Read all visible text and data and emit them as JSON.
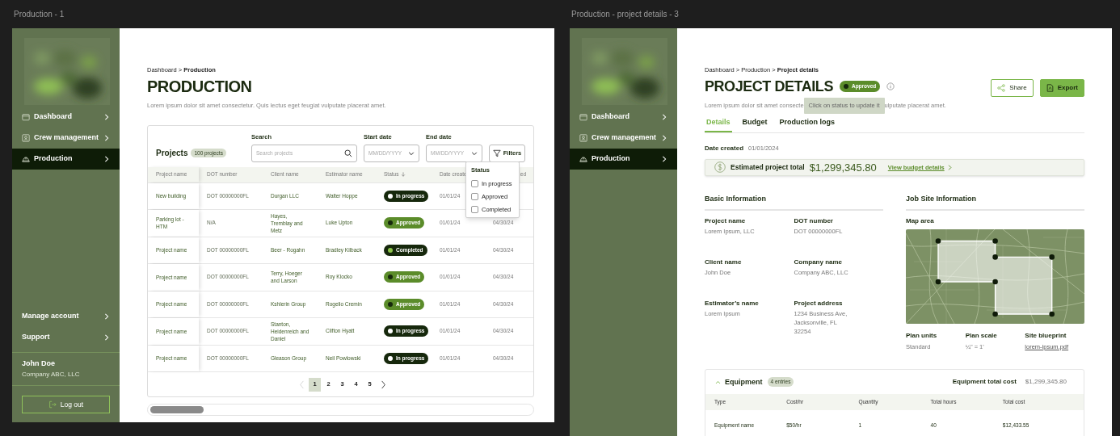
{
  "production_frame": {
    "label": "Production - 1",
    "sidebar": {
      "nav": [
        {
          "label": "Dashboard",
          "selected": false
        },
        {
          "label": "Crew management",
          "selected": false
        },
        {
          "label": "Production",
          "selected": true
        }
      ],
      "account_links": [
        "Manage account",
        "Support"
      ],
      "user": {
        "name": "John Doe",
        "company": "Company ABC, LLC"
      },
      "logout_button": "Log out"
    },
    "breadcrumb": "Dashboard > **Production**",
    "title": "PRODUCTION",
    "description": "Lorem ipsum dolor sit amet consectetur. Quis lectus eget feugiat vulputate placerat amet.",
    "projects": {
      "title": "Projects",
      "count_badge": "100 projects",
      "search": {
        "label": "Search",
        "placeholder": "Search projects"
      },
      "start_date": {
        "label": "Start date",
        "placeholder": "MM/DD/YYYY"
      },
      "end_date": {
        "label": "End date",
        "placeholder": "MM/DD/YYYY"
      },
      "filters_button": "Filters",
      "columns": [
        "Project name",
        "DOT number",
        "Client name",
        "Estimator name",
        "Status",
        "Date create",
        "ed"
      ],
      "rows": [
        {
          "project": "New building",
          "dot": "DOT 00000000FL",
          "client": "Durgan LLC",
          "estimator": "Walter Hoppe",
          "status": "In progress",
          "kind": "in_progress",
          "created": "01/01/24"
        },
        {
          "project": "Parking lot - HTM",
          "dot": "N/A",
          "client": "Hayes, Tremblay and Metz",
          "estimator": "Luke Upton",
          "status": "Approved",
          "kind": "approved",
          "created": "01/01/24",
          "completed": "04/30/24"
        },
        {
          "project": "Project name",
          "dot": "DOT 00000000FL",
          "client": "Beer - Rogahn",
          "estimator": "Bradley Kilback",
          "status": "Completed",
          "kind": "completed",
          "created": "01/01/24",
          "completed": "04/30/24"
        },
        {
          "project": "Project name",
          "dot": "DOT 00000000FL",
          "client": "Terry, Hoeger and Larson",
          "estimator": "Roy Klocko",
          "status": "Approved",
          "kind": "approved",
          "created": "01/01/24",
          "completed": "04/30/24"
        },
        {
          "project": "Project name",
          "dot": "DOT 00000000FL",
          "client": "Kshlerin Group",
          "estimator": "Rogelio Cremin",
          "status": "Approved",
          "kind": "approved",
          "created": "01/01/24",
          "completed": "04/30/24"
        },
        {
          "project": "Project name",
          "dot": "DOT 00000000FL",
          "client": "Stanton, Heidenreich and Daniel",
          "estimator": "Clifton Hyatt",
          "status": "In progress",
          "kind": "in_progress",
          "created": "01/01/24",
          "completed": "04/30/24"
        },
        {
          "project": "Project name",
          "dot": "DOT 00000000FL",
          "client": "Gleason Group",
          "estimator": "Neil Powlowski",
          "status": "In progress",
          "kind": "in_progress",
          "created": "01/01/24",
          "completed": "04/30/24"
        }
      ],
      "status_filter": {
        "title": "Status",
        "options": [
          {
            "label": "In progress",
            "checked": false
          },
          {
            "label": "Approved",
            "checked": false
          },
          {
            "label": "Completed",
            "checked": false
          }
        ]
      },
      "pagination": {
        "previous": {
          "disabled": true
        },
        "next": {
          "disabled": false
        },
        "pages": [
          {
            "label": "1",
            "selected": true
          },
          {
            "label": "2",
            "selected": false
          },
          {
            "label": "3",
            "selected": false
          },
          {
            "label": "4",
            "selected": false
          },
          {
            "label": "5",
            "selected": false
          }
        ]
      }
    }
  },
  "details_frame": {
    "label": "Production - project details - 3",
    "sidebar": {
      "nav": [
        {
          "label": "Dashboard",
          "selected": false
        },
        {
          "label": "Crew management",
          "selected": false
        },
        {
          "label": "Production",
          "selected": true
        }
      ]
    },
    "breadcrumb": "Dashboard > Production > **Project details**",
    "title": "PROJECT DETAILS",
    "status_badge": {
      "label": "Approved",
      "kind": "approved"
    },
    "tooltip": "Click on status to update it",
    "description_visible_parts": [
      "Lorem ipsum dolor sit amet consecte",
      "ulputate placerat amet."
    ],
    "actions": [
      {
        "label": "Share",
        "kind": "outline"
      },
      {
        "label": "Export",
        "kind": "primary"
      }
    ],
    "tabs": [
      {
        "label": "Details",
        "selected": true
      },
      {
        "label": "Budget",
        "selected": false
      },
      {
        "label": "Production logs",
        "selected": false
      }
    ],
    "date_created": {
      "label": "Date created",
      "value": "01/01/2024"
    },
    "estimate": {
      "label": "Estimated project total",
      "amount": "$1,299,345.80",
      "link": "View budget details"
    },
    "basic_information": {
      "title": "Basic Information",
      "fields": [
        {
          "label": "Project name",
          "value": "Lorem Ipsum, LLC"
        },
        {
          "label": "DOT number",
          "value": "DOT 00000000FL"
        },
        {
          "label": "Client name",
          "value": "John Doe"
        },
        {
          "label": "Company name",
          "value": "Company ABC, LLC"
        },
        {
          "label": "Estimator’s name",
          "value": "Lorem Ipsum"
        },
        {
          "label": "Project address",
          "value": "1234 Business Ave, Jacksonville, FL 32254"
        }
      ]
    },
    "job_site": {
      "title": "Job Site Information",
      "map_label": "Map area",
      "plan": [
        {
          "label": "Plan units",
          "value": "Standard",
          "kind": "text"
        },
        {
          "label": "Plan scale",
          "value": "¼\" = 1'",
          "kind": "text"
        },
        {
          "label": "Site blueprint",
          "value": "lorem-ipsum.pdf",
          "kind": "link"
        }
      ]
    },
    "equipment": {
      "title": "Equipment",
      "count_badge": "4 entries",
      "expanded": true,
      "total_label": "Equipment total cost",
      "total": "$1,299,345.80",
      "columns": [
        "Type",
        "Cost/hr",
        "Quantity",
        "Total hours",
        "Total cost"
      ],
      "rows": [
        [
          "Equipment name",
          "$50/hr",
          "1",
          "40",
          "$12,433.55"
        ]
      ]
    }
  }
}
